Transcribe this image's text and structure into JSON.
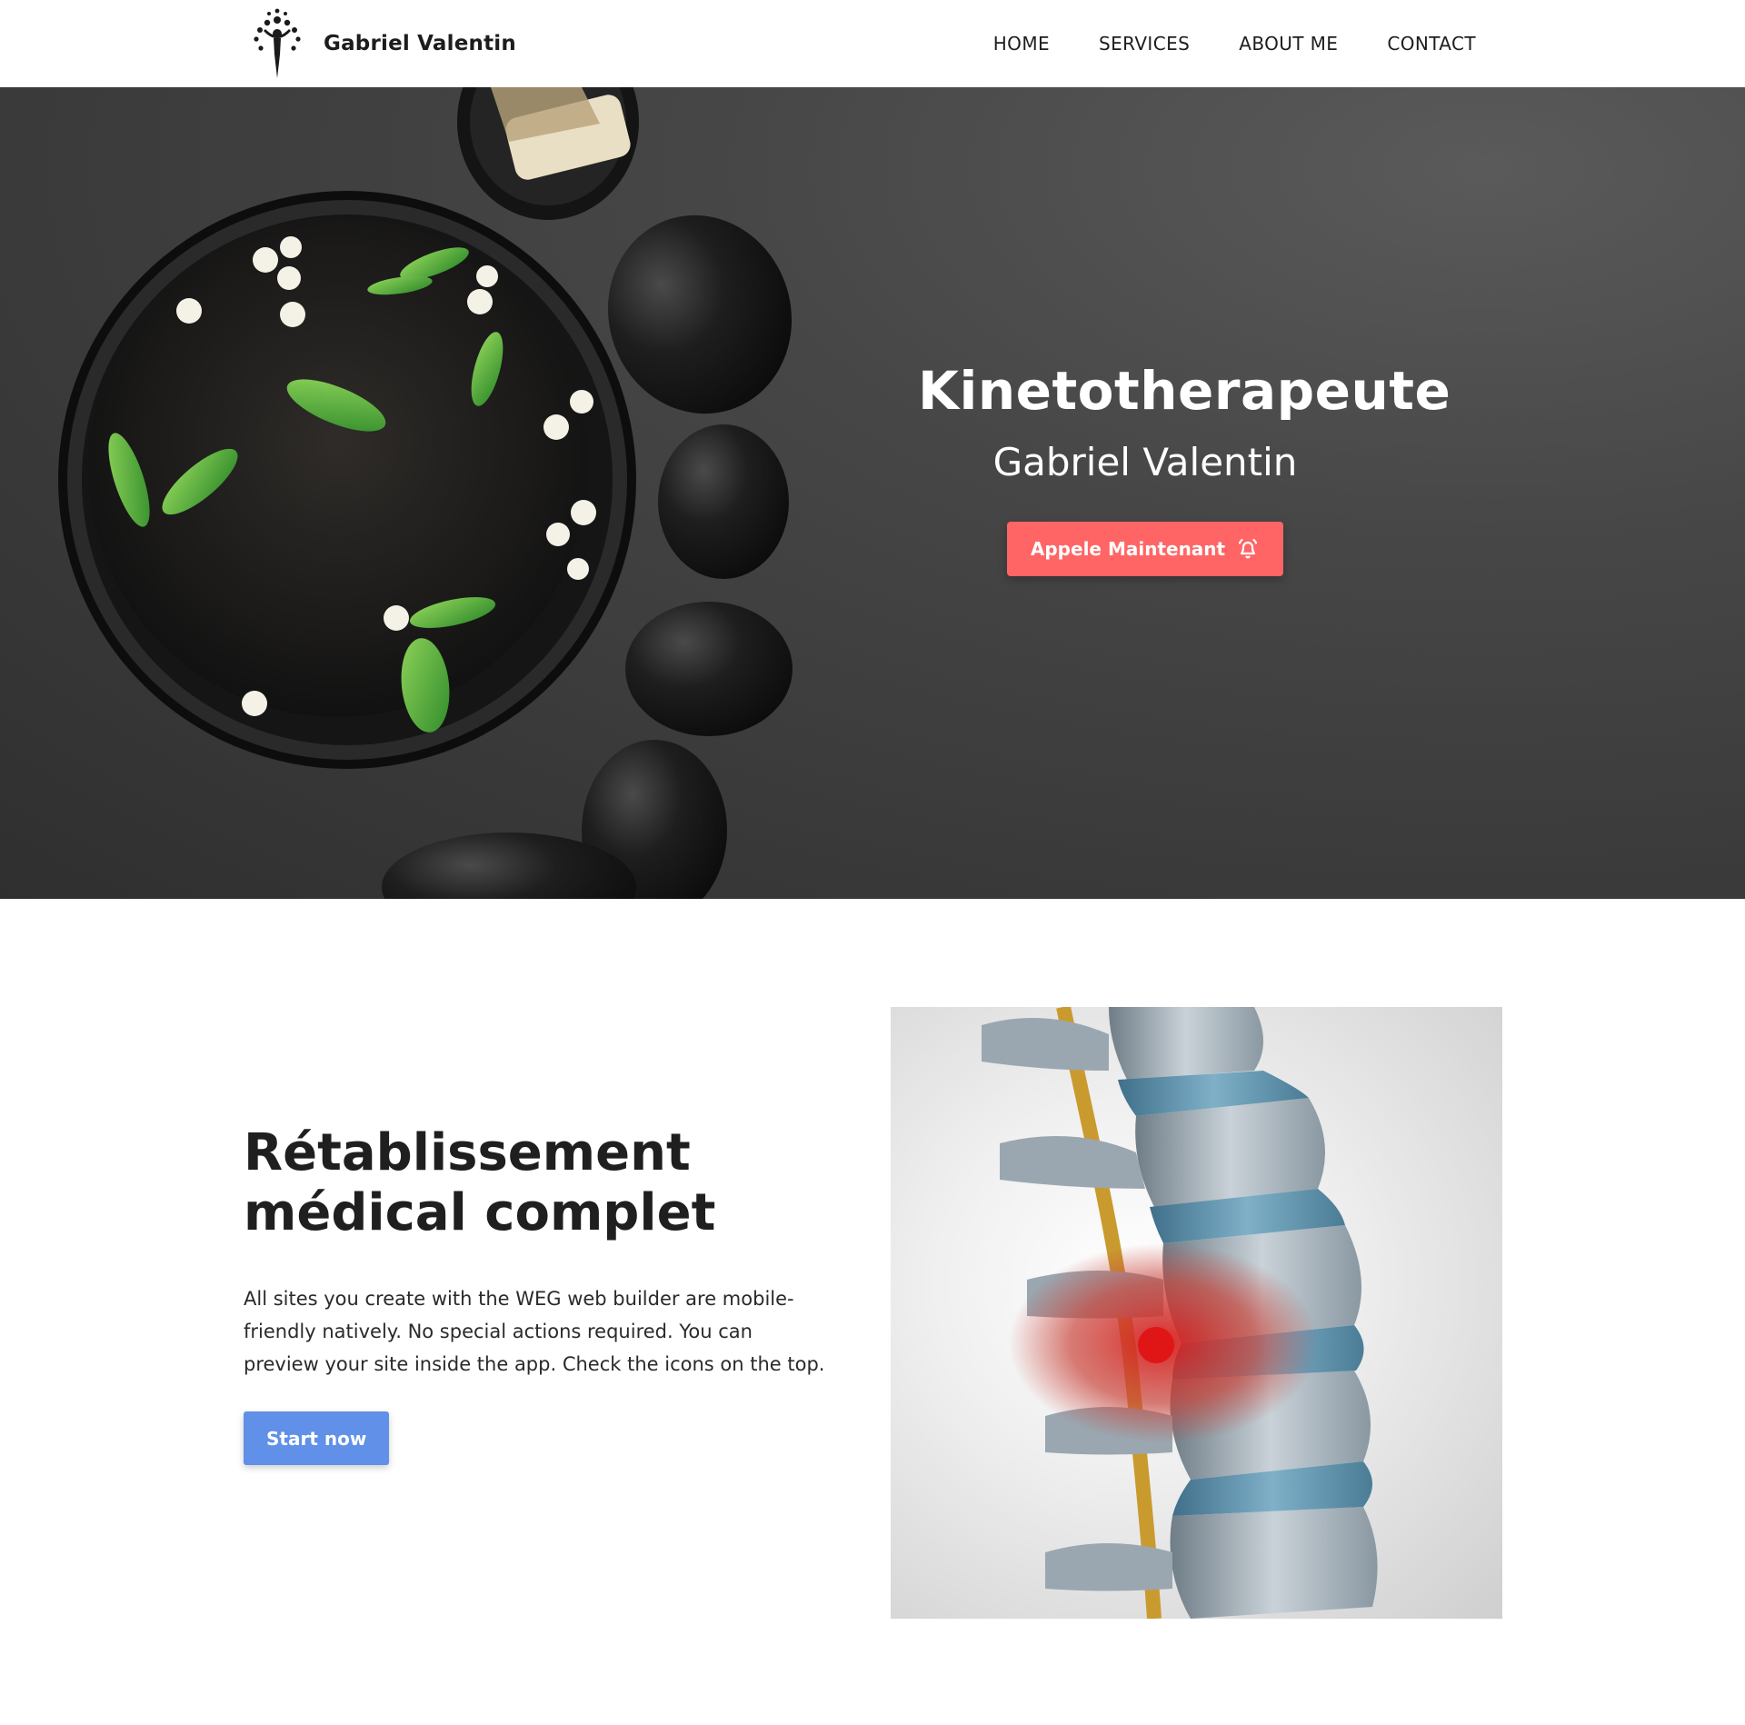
{
  "header": {
    "brand_name": "Gabriel Valentin",
    "logo_icon": "tree-figure-logo",
    "nav": [
      "HOME",
      "SERVICES",
      "ABOUT ME",
      "CONTACT"
    ]
  },
  "hero": {
    "title": "Kinetotherapeute",
    "subtitle": "Gabriel Valentin",
    "cta_label": "Appele Maintenant",
    "cta_icon": "bell-ringing-icon",
    "cta_color": "#ff6565",
    "image": "spa-bowl-stones-photo"
  },
  "feature": {
    "title_line1": "Rétablissement",
    "title_line2": "médical complet",
    "body": "All sites you create with the WEG web builder are mobile-friendly natively. No special actions required. You can preview your site inside the app. Check the icons on the top.",
    "button_label": "Start now",
    "button_color": "#6090e8",
    "image": "spine-herniated-disc-illustration"
  }
}
